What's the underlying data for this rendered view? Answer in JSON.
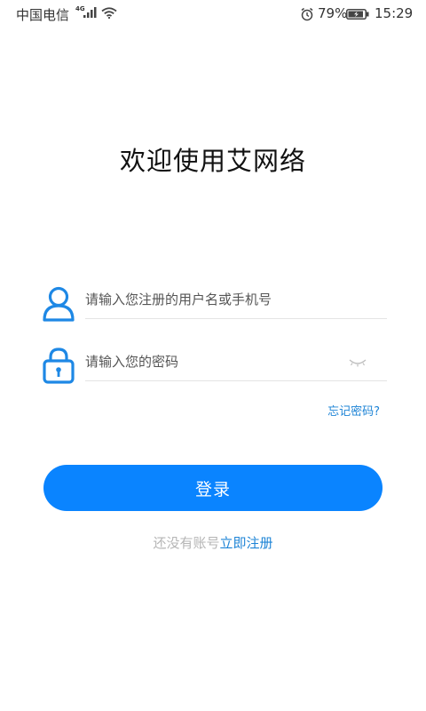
{
  "status_bar": {
    "carrier": "中国电信",
    "network": "4G",
    "battery": "79%",
    "time": "15:29"
  },
  "title": "欢迎使用艾网络",
  "form": {
    "username_placeholder": "请输入您注册的用户名或手机号",
    "password_placeholder": "请输入您的密码",
    "forgot_label": "忘记密码?",
    "login_label": "登录"
  },
  "register": {
    "prompt": "还没有账号",
    "link_label": "立即注册"
  },
  "colors": {
    "accent": "#0a84ff",
    "link": "#1e84d6",
    "icon": "#1e88e5",
    "muted": "#b5b5b5"
  },
  "icons": {
    "user": "user-icon",
    "lock": "lock-icon",
    "eye": "eye-closed-icon",
    "signal": "signal-icon",
    "wifi": "wifi-icon",
    "alarm": "alarm-icon",
    "battery": "battery-icon"
  }
}
